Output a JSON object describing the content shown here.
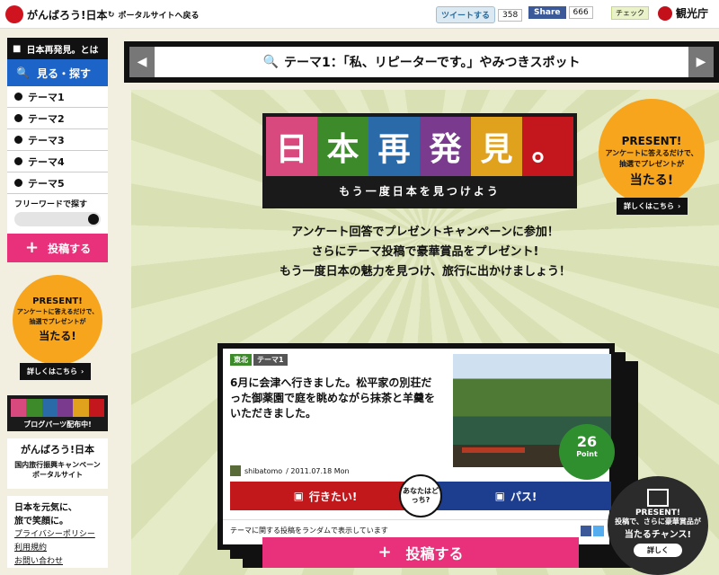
{
  "header": {
    "logo_text": "がんばろう!日本",
    "back_link": "ポータルサイトへ戻る",
    "tweet_label": "ツイートする",
    "tweet_count": "358",
    "fb_label": "Share",
    "fb_count": "666",
    "check_label": "チェック",
    "agency": "観光庁"
  },
  "sidebar": {
    "about": "日本再発見。とは",
    "browse": "見る・探す",
    "themes": [
      "テーマ1",
      "テーマ2",
      "テーマ3",
      "テーマ4",
      "テーマ5"
    ],
    "search_label": "フリーワードで探す",
    "post": "投稿する",
    "present": {
      "title": "PRESENT!",
      "line1": "アンケートに答えるだけで、",
      "line2": "抽選でプレゼントが",
      "hit": "当たる!",
      "detail": "詳しくはこちら"
    },
    "banner_caption": "ブログパーツ配布中!",
    "portal": {
      "title": "がんばろう!日本",
      "line1": "国内旅行振興キャンペーン",
      "line2": "ポータルサイト"
    },
    "slogan": [
      "日本を元気に、",
      "旅で笑顔に。"
    ],
    "links": [
      "プライバシーポリシー",
      "利用規約",
      "お問い合わせ"
    ]
  },
  "main": {
    "theme_title": "テーマ1：「私、リピーターです。」やみつきスポット",
    "hero_chars": [
      "日",
      "本",
      "再",
      "発",
      "見",
      "。"
    ],
    "hero_sub": "もう一度日本を見つけよう",
    "intro": [
      "アンケート回答でプレゼントキャンペーンに参加！",
      "さらにテーマ投稿で豪華賞品をプレゼント!",
      "もう一度日本の魅力を見つけ、旅行に出かけましょう！"
    ],
    "present": {
      "title": "PRESENT!",
      "line1": "アンケートに答えるだけで、",
      "line2": "抽選でプレゼントが",
      "hit": "当たる!",
      "detail": "詳しくはこちら"
    },
    "card": {
      "region_tag": "東北",
      "theme_tag": "テーマ1",
      "text": "6月に会津へ行きました。松平家の別荘だった御薬園で庭を眺めながら抹茶と羊羹をいただきました。",
      "author": "shibatomo",
      "date": "/ 2011.07.18 Mon",
      "points": "26",
      "points_unit": "Point",
      "want": "行きたい!",
      "which": "あなたはどっち?",
      "pass": "パス!",
      "random_note": "テーマに関する投稿をランダムで表示しています"
    },
    "big_post": "投稿する",
    "present_b": {
      "title": "PRESENT!",
      "line1": "投稿で、さらに豪華賞品が",
      "line2": "当たるチャンス!",
      "detail": "詳しく"
    }
  },
  "colors": {
    "pink": "#e8317a",
    "blue": "#1d64c8",
    "orange": "#f7a51c",
    "red": "#c2171b",
    "navy": "#1d3d8f"
  }
}
